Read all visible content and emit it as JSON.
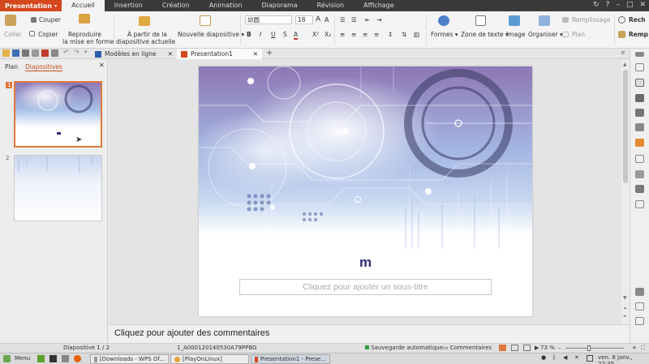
{
  "app": {
    "menu_button": "Presentation"
  },
  "menu_tabs": [
    "Accueil",
    "Insertion",
    "Création",
    "Animation",
    "Diaporama",
    "Révision",
    "Affichage"
  ],
  "ribbon": {
    "cut": "Couper",
    "copy": "Copier",
    "paste": "Coller",
    "format_painter_line1": "Reproduire",
    "format_painter_line2": "la mise en forme",
    "from_current_line1": "À partir de la",
    "from_current_line2": "diapositive actuelle",
    "new_slide": "Nouvelle diapositive",
    "font_name": "幼圆",
    "font_size": "18",
    "shapes": "Formes",
    "textbox": "Zone de texte",
    "image": "Image",
    "arrange": "Organiser",
    "fill": "Remplissage",
    "outline": "Plan",
    "find_line1": "Rech",
    "find_line2": "Remp"
  },
  "doc_tabs": {
    "templates": "Modèles en ligne",
    "document": "Presentation1"
  },
  "left_panel": {
    "tab_outline": "Plan",
    "tab_slides": "Diapositives",
    "slide_numbers": [
      "1",
      "2"
    ]
  },
  "slide": {
    "title": "m",
    "subtitle_placeholder": "Cliquez pour ajouter un sous-titre"
  },
  "notes_placeholder": "Cliquez pour ajouter des commentaires",
  "status": {
    "slide_counter": "Diapositive 1 / 2",
    "theme": "1_A000120140530A79PPBG",
    "autosave": "Sauvegarde automatique",
    "comments": "Commentaires",
    "zoom": "73 %"
  },
  "taskbar": {
    "menu": "Menu",
    "tasks": [
      "[Downloads - WPS Of...",
      "[PlayOnLinux]",
      "Presentation1 - Prese..."
    ],
    "clock": "ven.  8 janv., 22:35"
  },
  "colors": {
    "accent": "#d5471c",
    "title": "#2f2c7a",
    "selection": "#e0783c"
  }
}
